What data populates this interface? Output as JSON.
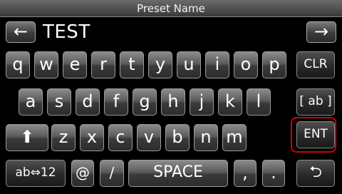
{
  "title": "Preset Name",
  "input": {
    "value": "TEST",
    "left_arrow": "←",
    "right_arrow": "→"
  },
  "keys": {
    "row1": [
      "q",
      "w",
      "e",
      "r",
      "t",
      "y",
      "u",
      "i",
      "o",
      "p"
    ],
    "row2": [
      "a",
      "s",
      "d",
      "f",
      "g",
      "h",
      "j",
      "k",
      "l"
    ],
    "row3": [
      "z",
      "x",
      "c",
      "v",
      "b",
      "n",
      "m"
    ],
    "clr": "CLR",
    "ab": "[ ab ]",
    "ent": "ENT",
    "shift": "⬆",
    "mode": "ab⇔12",
    "at": "@",
    "slash": "/",
    "space": "SPACE",
    "comma": ",",
    "period": ".",
    "back": "⮌"
  }
}
